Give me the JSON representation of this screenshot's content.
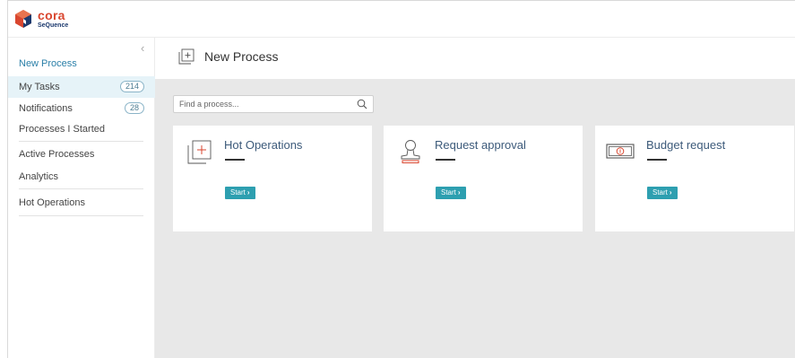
{
  "brand": {
    "name": "cora",
    "subname": "SeQuence",
    "colors": {
      "orange": "#d9462f",
      "blue": "#1d3a6e",
      "teal": "#2d9fb0"
    }
  },
  "sidebar": {
    "collapse_icon": "chevron-left-icon",
    "new_process": "New Process",
    "items": [
      {
        "label": "My Tasks",
        "badge": "214",
        "active": true
      },
      {
        "label": "Notifications",
        "badge": "28"
      },
      {
        "label": "Processes I Started"
      },
      {
        "label": "Active Processes"
      },
      {
        "label": "Analytics"
      },
      {
        "label": "Hot Operations"
      }
    ]
  },
  "header": {
    "icon": "new-process-icon",
    "title": "New Process"
  },
  "search": {
    "placeholder": "Find a process...",
    "icon": "search-icon"
  },
  "cards": [
    {
      "title": "Hot Operations",
      "icon": "new-process-icon",
      "start_label": "Start"
    },
    {
      "title": "Request approval",
      "icon": "stamp-icon",
      "start_label": "Start"
    },
    {
      "title": "Budget request",
      "icon": "banknote-icon",
      "start_label": "Start"
    }
  ]
}
